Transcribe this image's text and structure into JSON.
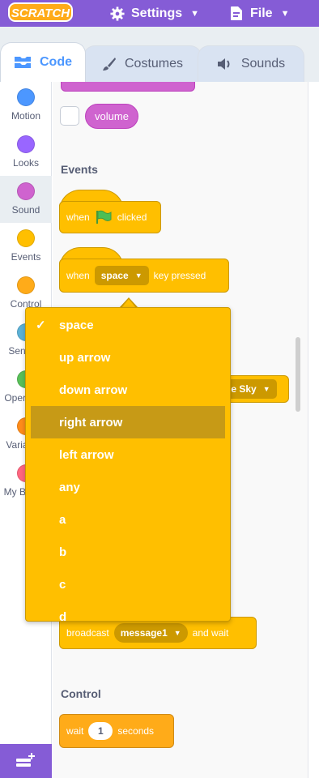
{
  "menubar": {
    "logo": "SCRATCH",
    "settings_label": "Settings",
    "file_label": "File",
    "bg_color": "#855cd6"
  },
  "tabs": {
    "code": "Code",
    "costumes": "Costumes",
    "sounds": "Sounds"
  },
  "categories": [
    {
      "label": "Motion",
      "color": "#4c97ff"
    },
    {
      "label": "Looks",
      "color": "#9966ff"
    },
    {
      "label": "Sound",
      "color": "#cf63cf"
    },
    {
      "label": "Events",
      "color": "#ffbf00"
    },
    {
      "label": "Control",
      "color": "#ffab19"
    },
    {
      "label": "Sensing",
      "color": "#5cb1d6"
    },
    {
      "label": "Operators",
      "color": "#59c059"
    },
    {
      "label": "Variables",
      "color": "#ff8c1a"
    },
    {
      "label": "My Blocks",
      "color": "#ff6680"
    }
  ],
  "palette": {
    "volume_label": "volume",
    "events_heading": "Events",
    "when_flag": {
      "when": "when",
      "clicked": "clicked"
    },
    "when_key": {
      "when": "when",
      "key": "space",
      "pressed": "key pressed"
    },
    "backdrop_partial": "ue Sky",
    "broadcast_wait": {
      "broadcast": "broadcast",
      "message": "message1",
      "and_wait": "and wait"
    },
    "control_heading": "Control",
    "wait": {
      "wait": "wait",
      "value": "1",
      "seconds": "seconds"
    }
  },
  "dropdown": {
    "selected": "space",
    "highlighted": "right arrow",
    "items": [
      "space",
      "up arrow",
      "down arrow",
      "right arrow",
      "left arrow",
      "any",
      "a",
      "b",
      "c",
      "d"
    ]
  }
}
